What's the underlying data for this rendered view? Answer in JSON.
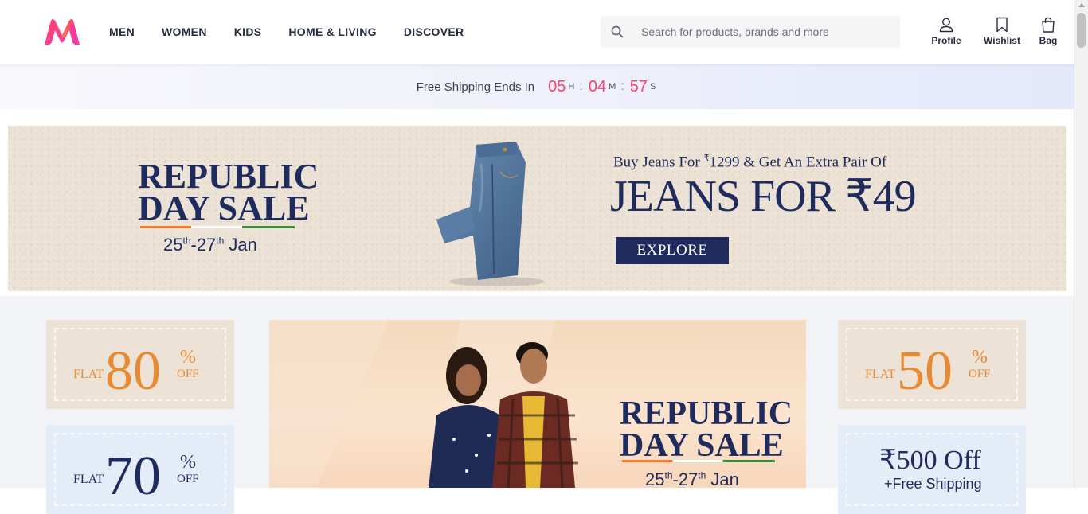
{
  "brand": {
    "name": "Myntra"
  },
  "nav": {
    "items": [
      "MEN",
      "WOMEN",
      "KIDS",
      "HOME & LIVING",
      "DISCOVER"
    ]
  },
  "search": {
    "placeholder": "Search for products, brands and more"
  },
  "actions": {
    "profile": "Profile",
    "wishlist": "Wishlist",
    "bag": "Bag"
  },
  "countdown": {
    "label": "Free Shipping Ends In",
    "hours": "05",
    "h": "H",
    "minutes": "04",
    "m": "M",
    "seconds": "57",
    "s": "S"
  },
  "hero": {
    "title_line1": "REPUBLIC",
    "title_line2": "DAY SALE",
    "date_a": "25",
    "date_a_sup": "th",
    "date_b": "-27",
    "date_b_sup": "th",
    "date_month": " Jan",
    "offer_small_a": "Buy Jeans For ",
    "offer_small_sup": "₹",
    "offer_small_b": "1299 & Get An Extra Pair Of",
    "offer_big": "JEANS FOR ₹49",
    "cta": "EXPLORE"
  },
  "tiles": {
    "left1": {
      "flat": "FLAT",
      "value": "80",
      "pct": "%",
      "off": "OFF"
    },
    "left2": {
      "flat": "FLAT",
      "value": "70",
      "pct": "%",
      "off": "OFF"
    },
    "right1": {
      "flat": "FLAT",
      "value": "50",
      "pct": "%",
      "off": "OFF"
    },
    "right2": {
      "line1": "₹500 Off",
      "line2": "+Free Shipping"
    }
  },
  "center_banner": {
    "title_line1": "REPUBLIC",
    "title_line2": "DAY SALE",
    "date_a": "25",
    "date_a_sup": "th",
    "date_b": "-27",
    "date_b_sup": "th",
    "date_month": " Jan"
  },
  "colors": {
    "accent": "#ff3f6c",
    "navy": "#1e2b5c",
    "orange": "#e88a33"
  }
}
